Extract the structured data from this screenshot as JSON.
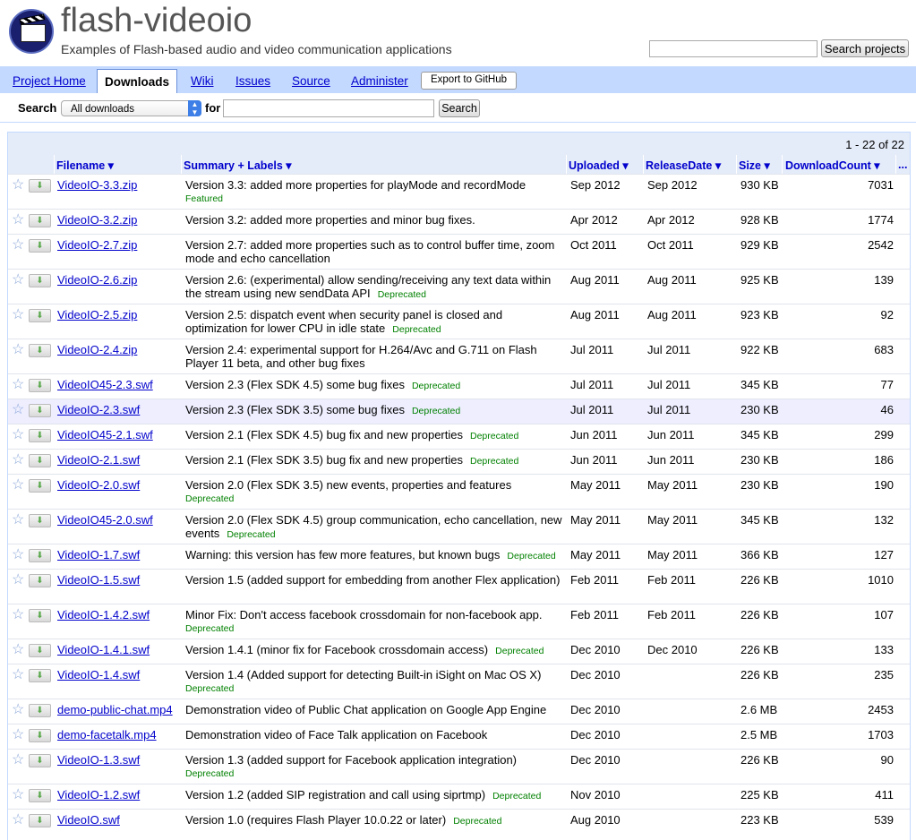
{
  "project": {
    "name": "flash-videoio",
    "summary": "Examples of Flash-based audio and video communication applications",
    "search_button": "Search projects"
  },
  "tabs": {
    "project_home": "Project Home",
    "downloads": "Downloads",
    "wiki": "Wiki",
    "issues": "Issues",
    "source": "Source",
    "administer": "Administer",
    "export": "Export to GitHub"
  },
  "search": {
    "label": "Search",
    "scope": "All downloads",
    "for_label": "for",
    "button": "Search"
  },
  "results": {
    "pager": "1 - 22 of 22",
    "columns": {
      "filename": "Filename ▾",
      "summary": "Summary + Labels ▾",
      "uploaded": "Uploaded ▾",
      "release": "ReleaseDate ▾",
      "size": "Size ▾",
      "count": "DownloadCount ▾",
      "more": "..."
    },
    "rows": [
      {
        "file": "VideoIO-3.3.zip",
        "summary": "Version 3.3: added more properties for playMode and recordMode",
        "label": "Featured",
        "uploaded": "Sep 2012",
        "release": "Sep 2012",
        "size": "930 KB",
        "count": "7031"
      },
      {
        "file": "VideoIO-3.2.zip",
        "summary": "Version 3.2: added more properties and minor bug fixes.",
        "label": "",
        "uploaded": "Apr 2012",
        "release": "Apr 2012",
        "size": "928 KB",
        "count": "1774"
      },
      {
        "file": "VideoIO-2.7.zip",
        "summary": "Version 2.7: added more properties such as to control buffer time, zoom mode and echo cancellation",
        "label": "",
        "uploaded": "Oct 2011",
        "release": "Oct 2011",
        "size": "929 KB",
        "count": "2542"
      },
      {
        "file": "VideoIO-2.6.zip",
        "summary": "Version 2.6: (experimental) allow sending/receiving any text data within the stream using new sendData API",
        "label": "Deprecated",
        "uploaded": "Aug 2011",
        "release": "Aug 2011",
        "size": "925 KB",
        "count": "139"
      },
      {
        "file": "VideoIO-2.5.zip",
        "summary": "Version 2.5: dispatch event when security panel is closed and optimization for lower CPU in idle state",
        "label": "Deprecated",
        "uploaded": "Aug 2011",
        "release": "Aug 2011",
        "size": "923 KB",
        "count": "92"
      },
      {
        "file": "VideoIO-2.4.zip",
        "summary": "Version 2.4: experimental support for H.264/Avc and G.711 on Flash Player 11 beta, and other bug fixes",
        "label": "",
        "uploaded": "Jul 2011",
        "release": "Jul 2011",
        "size": "922 KB",
        "count": "683"
      },
      {
        "file": "VideoIO45-2.3.swf",
        "summary": "Version 2.3 (Flex SDK 4.5) some bug fixes",
        "label": "Deprecated",
        "uploaded": "Jul 2011",
        "release": "Jul 2011",
        "size": "345 KB",
        "count": "77"
      },
      {
        "file": "VideoIO-2.3.swf",
        "summary": "Version 2.3 (Flex SDK 3.5) some bug fixes",
        "label": "Deprecated",
        "uploaded": "Jul 2011",
        "release": "Jul 2011",
        "size": "230 KB",
        "count": "46"
      },
      {
        "file": "VideoIO45-2.1.swf",
        "summary": "Version 2.1 (Flex SDK 4.5) bug fix and new properties",
        "label": "Deprecated",
        "uploaded": "Jun 2011",
        "release": "Jun 2011",
        "size": "345 KB",
        "count": "299"
      },
      {
        "file": "VideoIO-2.1.swf",
        "summary": "Version 2.1 (Flex SDK 3.5) bug fix and new properties",
        "label": "Deprecated",
        "uploaded": "Jun 2011",
        "release": "Jun 2011",
        "size": "230 KB",
        "count": "186"
      },
      {
        "file": "VideoIO-2.0.swf",
        "summary": "Version 2.0 (Flex SDK 3.5) new events, properties and features",
        "label": "Deprecated",
        "uploaded": "May 2011",
        "release": "May 2011",
        "size": "230 KB",
        "count": "190"
      },
      {
        "file": "VideoIO45-2.0.swf",
        "summary": "Version 2.0 (Flex SDK 4.5) group communication, echo cancellation, new events",
        "label": "Deprecated",
        "uploaded": "May 2011",
        "release": "May 2011",
        "size": "345 KB",
        "count": "132"
      },
      {
        "file": "VideoIO-1.7.swf",
        "summary": "Warning: this version has few more features, but known bugs",
        "label": "Deprecated",
        "uploaded": "May 2011",
        "release": "May 2011",
        "size": "366 KB",
        "count": "127"
      },
      {
        "file": "VideoIO-1.5.swf",
        "summary": "Version 1.5 (added support for embedding from another Flex application)",
        "label": "",
        "uploaded": "Feb 2011",
        "release": "Feb 2011",
        "size": "226 KB",
        "count": "1010"
      },
      {
        "file": "VideoIO-1.4.2.swf",
        "summary": "Minor Fix: Don't access facebook crossdomain for non-facebook app.",
        "label": "Deprecated",
        "uploaded": "Feb 2011",
        "release": "Feb 2011",
        "size": "226 KB",
        "count": "107"
      },
      {
        "file": "VideoIO-1.4.1.swf",
        "summary": "Version 1.4.1 (minor fix for Facebook crossdomain access)",
        "label": "Deprecated",
        "uploaded": "Dec 2010",
        "release": "Dec 2010",
        "size": "226 KB",
        "count": "133"
      },
      {
        "file": "VideoIO-1.4.swf",
        "summary": "Version 1.4 (Added support for detecting Built-in iSight on Mac OS X)",
        "label": "Deprecated",
        "uploaded": "Dec 2010",
        "release": "",
        "size": "226 KB",
        "count": "235"
      },
      {
        "file": "demo-public-chat.mp4",
        "summary": "Demonstration video of Public Chat application on Google App Engine",
        "label": "",
        "uploaded": "Dec 2010",
        "release": "",
        "size": "2.6 MB",
        "count": "2453"
      },
      {
        "file": "demo-facetalk.mp4",
        "summary": "Demonstration video of Face Talk application on Facebook",
        "label": "",
        "uploaded": "Dec 2010",
        "release": "",
        "size": "2.5 MB",
        "count": "1703"
      },
      {
        "file": "VideoIO-1.3.swf",
        "summary": "Version 1.3 (added support for Facebook application integration)",
        "label": "Deprecated",
        "uploaded": "Dec 2010",
        "release": "",
        "size": "226 KB",
        "count": "90"
      },
      {
        "file": "VideoIO-1.2.swf",
        "summary": "Version 1.2 (added SIP registration and call using siprtmp)",
        "label": "Deprecated",
        "uploaded": "Nov 2010",
        "release": "",
        "size": "225 KB",
        "count": "411"
      },
      {
        "file": "VideoIO.swf",
        "summary": "Version 1.0 (requires Flash Player 10.0.22 or later)",
        "label": "Deprecated",
        "uploaded": "Aug 2010",
        "release": "",
        "size": "223 KB",
        "count": "539"
      }
    ]
  }
}
